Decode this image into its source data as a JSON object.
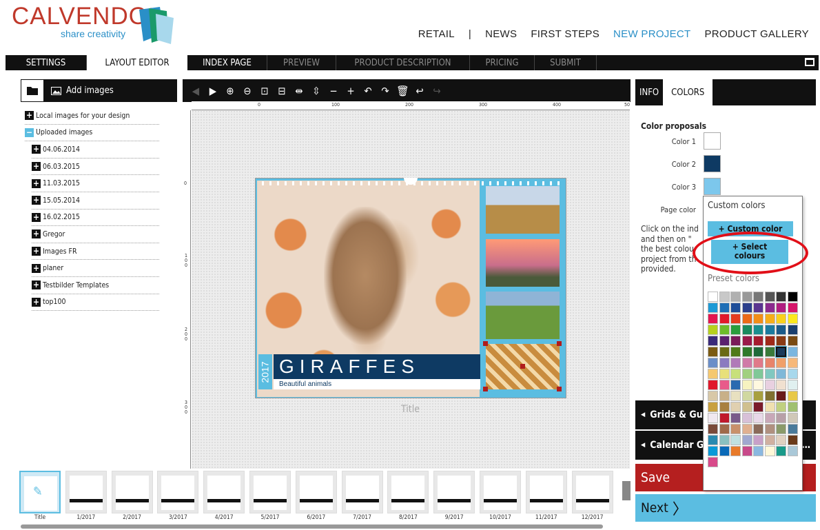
{
  "logo": {
    "brand": "CALVENDO",
    "registered": "®",
    "tagline": "share creativity"
  },
  "topnav": [
    {
      "label": "RETAIL"
    },
    {
      "label": "|"
    },
    {
      "label": "NEWS"
    },
    {
      "label": "FIRST STEPS"
    },
    {
      "label": "NEW PROJECT"
    },
    {
      "label": "PRODUCT GALLERY"
    }
  ],
  "tabs": [
    {
      "label": "SETTINGS"
    },
    {
      "label": "LAYOUT EDITOR"
    },
    {
      "label": "INDEX PAGE"
    },
    {
      "label": "PREVIEW"
    },
    {
      "label": "PRODUCT DESCRIPTION"
    },
    {
      "label": "PRICING"
    },
    {
      "label": "SUBMIT"
    }
  ],
  "left_panel": {
    "add_images": "Add images",
    "tree": [
      {
        "label": "Local images for your design",
        "sign": "+"
      },
      {
        "label": "Uploaded images",
        "sign": "−"
      }
    ],
    "folders": [
      "04.06.2014",
      "06.03.2015",
      "11.03.2015",
      "15.05.2014",
      "16.02.2015",
      "Gregor",
      "Images FR",
      "planer",
      "Testbilder Templates",
      "top100"
    ]
  },
  "rulers": {
    "h": [
      "0",
      "100",
      "200",
      "300",
      "400",
      "50"
    ],
    "v": [
      "0",
      "1\n0\n0",
      "2\n0\n0",
      "3\n0\n0"
    ]
  },
  "cover": {
    "title": "GIRAFFES",
    "subtitle": "Beautiful animals",
    "year": "2017",
    "caption": "Title"
  },
  "pages": [
    "Title",
    "1/2017",
    "2/2017",
    "3/2017",
    "4/2017",
    "5/2017",
    "6/2017",
    "7/2017",
    "8/2017",
    "9/2017",
    "10/2017",
    "11/2017",
    "12/2017"
  ],
  "right_panel": {
    "tabs": [
      "INFO",
      "COLORS"
    ],
    "heading": "Color proposals",
    "colors": [
      {
        "label": "Color 1",
        "hex": "#ffffff"
      },
      {
        "label": "Color 2",
        "hex": "#0e3a63"
      },
      {
        "label": "Color 3",
        "hex": "#7cc7ec"
      }
    ],
    "page_color_label": "Page color",
    "help_text": "Click on the ind and then on \" the best colou project from th provided.",
    "accordions": [
      "Grids & Gu",
      "Calendar G"
    ],
    "save": "Save",
    "next": "Next"
  },
  "popup": {
    "title": "Custom colors",
    "custom_btn": "+ Custom color",
    "select_btn_line1": "+ Select",
    "select_btn_line2": "colours",
    "preset_label": "Preset colors",
    "preset": [
      "#ffffff",
      "#c8c8c8",
      "#b0b0b0",
      "#999999",
      "#777777",
      "#555555",
      "#333333",
      "#000000",
      "#1d9ad6",
      "#1f6fb6",
      "#1f4e99",
      "#2c3f8c",
      "#5a3590",
      "#8b2a8e",
      "#b01e80",
      "#d5156a",
      "#e4154f",
      "#e2182b",
      "#e63c1f",
      "#ec6a17",
      "#f28e18",
      "#f6ae1a",
      "#f9d01d",
      "#fbe81e",
      "#b6d11d",
      "#6dbb2b",
      "#2a9d3d",
      "#1a8a5e",
      "#1a8f8f",
      "#1a7a9e",
      "#1a5a8a",
      "#1a3f6f",
      "#3a2a7a",
      "#5a1f6f",
      "#7a1a5a",
      "#9a1a4a",
      "#a51c2e",
      "#a02a1a",
      "#8a3a14",
      "#7a4a12",
      "#7a5a12",
      "#6a6a14",
      "#4f7a1a",
      "#2f7a2a",
      "#1f6a3a",
      "#3a7a3a",
      "#1a3a5a",
      "#7ab6e0",
      "#6a8ec8",
      "#8a7ac0",
      "#b07ab8",
      "#d07aa8",
      "#e07a8a",
      "#e8846a",
      "#f0a06a",
      "#f6b87a",
      "#f5c870",
      "#e8e07a",
      "#c8e07a",
      "#a0d080",
      "#80c898",
      "#80c8c0",
      "#80b8d8",
      "#a8d8ec",
      "#e0182b",
      "#e85a8a",
      "#2a6ab0",
      "#f7f3c0",
      "#fff8e0",
      "#e8d0e0",
      "#f0e0d0",
      "#e0f0f0",
      "#d8c8a8",
      "#c8b088",
      "#e8e0c0",
      "#d0d8a0",
      "#a8a040",
      "#807030",
      "#6a1a1a",
      "#e8c848",
      "#c8a040",
      "#a88040",
      "#e0d0b0",
      "#d0c090",
      "#7a1a2a",
      "#f0e0b0",
      "#c0d080",
      "#a0c070",
      "#f0e8f0",
      "#c0182b",
      "#7a5a8a",
      "#d8c0d8",
      "#e8d8e8",
      "#c8a8b8",
      "#b8a0a8",
      "#d0c8b8",
      "#7a4a3a",
      "#a06a4a",
      "#c8906a",
      "#e0b090",
      "#8a6a5a",
      "#b09080",
      "#8a9a6a",
      "#4a7a9a",
      "#2a8ab0",
      "#8ac0c0",
      "#c0e0e0",
      "#a0a8d0",
      "#c8a0c8",
      "#d0b0a0",
      "#e0d0c0",
      "#6a3a1a",
      "#0a9ad8",
      "#0a6ab8",
      "#e87a2a",
      "#c84a8a",
      "#8ab8e0",
      "#fff8d8",
      "#1a9a8a",
      "#aac8d8",
      "#d84a8a"
    ]
  }
}
